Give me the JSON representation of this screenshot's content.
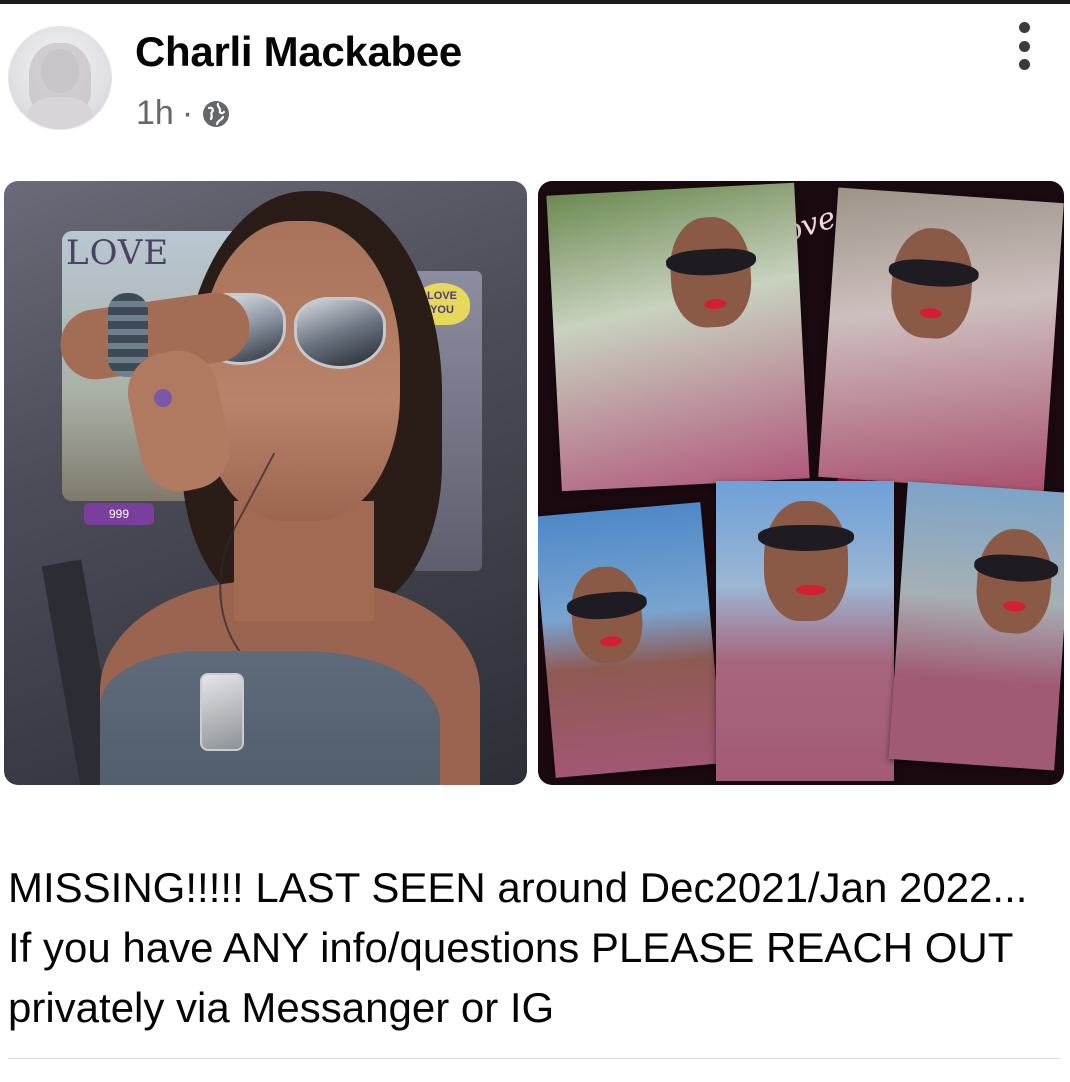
{
  "post": {
    "author": "Charli Mackabee",
    "time": "1h",
    "separator": "·",
    "privacy_icon": "globe-icon",
    "more_icon": "more-vertical-icon",
    "caption": "MISSING!!!!! LAST SEEN around Dec2021/Jan 2022... If you have ANY info/questions PLEASE REACH OUT privately via Messanger or IG"
  },
  "photos": {
    "left": {
      "sticker_text": "LOVE",
      "tag_text": "LOVE YOU",
      "badge_text": "999"
    },
    "right": {
      "script_text": "love"
    }
  },
  "colors": {
    "author_text": "#050505",
    "meta_text": "#65676b",
    "divider": "#dadde1"
  }
}
